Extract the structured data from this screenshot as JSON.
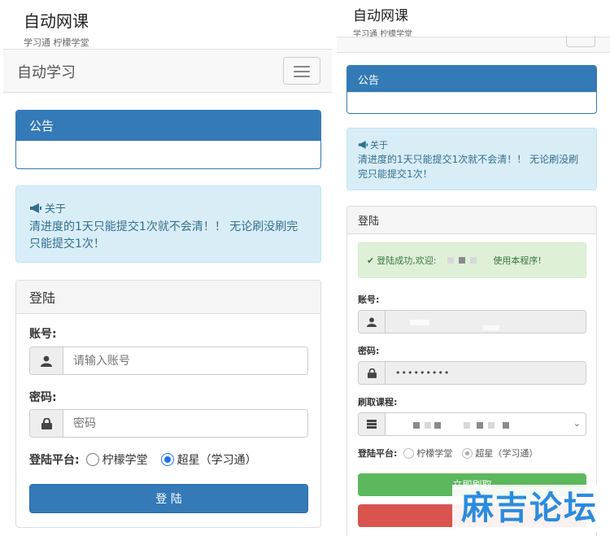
{
  "app": {
    "title": "自动网课",
    "subtitle": "学习通 柠檬学堂"
  },
  "navbar": {
    "brand": "自动学习"
  },
  "notice": {
    "title": "公告",
    "body": ""
  },
  "about": {
    "title": "关于",
    "text": "清进度的1天只能提交1次就不会清！！ 无论刷没刷完只能提交1次！"
  },
  "login_form": {
    "title": "登陆",
    "account_label": "账号:",
    "account_placeholder": "请输入账号",
    "password_label": "密码:",
    "password_placeholder": "密码",
    "platform_label": "登陆平台:",
    "platforms": [
      "柠檬学堂",
      "超星（学习通）"
    ],
    "selected_platform": "超星（学习通）",
    "submit_label": "登 陆"
  },
  "result_panel": {
    "title": "登陆",
    "success_prefix": "登陆成功,欢迎:",
    "success_suffix": "使用本程序!",
    "account_label": "账号:",
    "password_label": "密码:",
    "password_value": "•••••••••",
    "course_label": "刷取课程:",
    "platform_label": "登陆平台:",
    "platforms": [
      "柠檬学堂",
      "超星（学习通）"
    ],
    "start_label": "立即刷取"
  },
  "watermark": "麻吉论坛",
  "colors": {
    "primary": "#337ab7",
    "info_bg": "#d9edf7",
    "info_text": "#31708f",
    "success": "#5cb85c",
    "danger": "#d9534f"
  }
}
